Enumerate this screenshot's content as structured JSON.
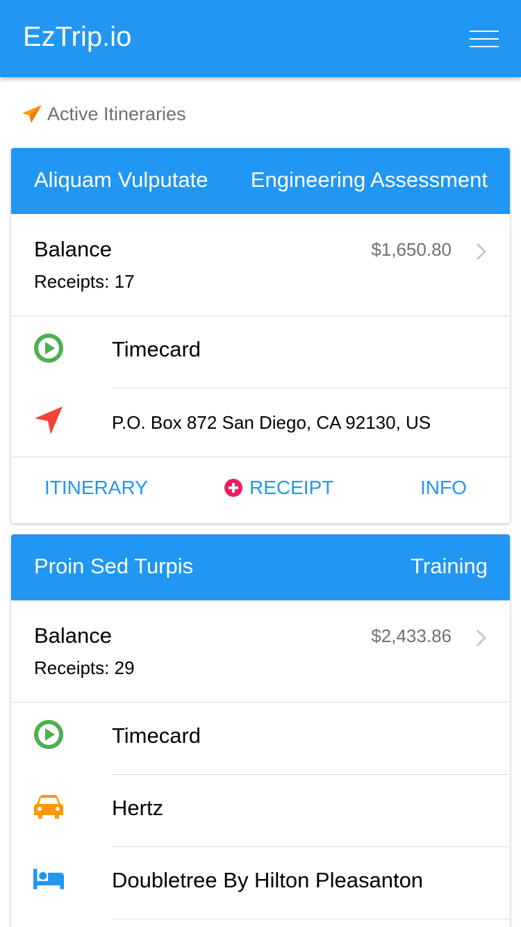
{
  "app": {
    "title": "EzTrip.io"
  },
  "section": {
    "title": "Active Itineraries"
  },
  "colors": {
    "brand": "#2196f3",
    "green": "#4caf50",
    "red": "#f44336",
    "orange": "#ff9800",
    "pink": "#e91e63"
  },
  "cards": [
    {
      "name": "Aliquam Vulputate",
      "type": "Engineering Assessment",
      "balance_label": "Balance",
      "amount": "$1,650.80",
      "receipts": "Receipts: 17",
      "items": [
        {
          "icon": "play-circle-icon",
          "label": "Timecard"
        },
        {
          "icon": "location-arrow-icon",
          "label": "P.O. Box 872 San Diego, CA 92130, US"
        }
      ],
      "actions": {
        "itinerary": "ITINERARY",
        "receipt": "RECEIPT",
        "info": "INFO"
      }
    },
    {
      "name": "Proin Sed Turpis",
      "type": "Training",
      "balance_label": "Balance",
      "amount": "$2,433.86",
      "receipts": "Receipts: 29",
      "items": [
        {
          "icon": "play-circle-icon",
          "label": "Timecard"
        },
        {
          "icon": "car-icon",
          "label": "Hertz"
        },
        {
          "icon": "bed-icon",
          "label": "Doubletree By Hilton Pleasanton"
        }
      ]
    }
  ]
}
